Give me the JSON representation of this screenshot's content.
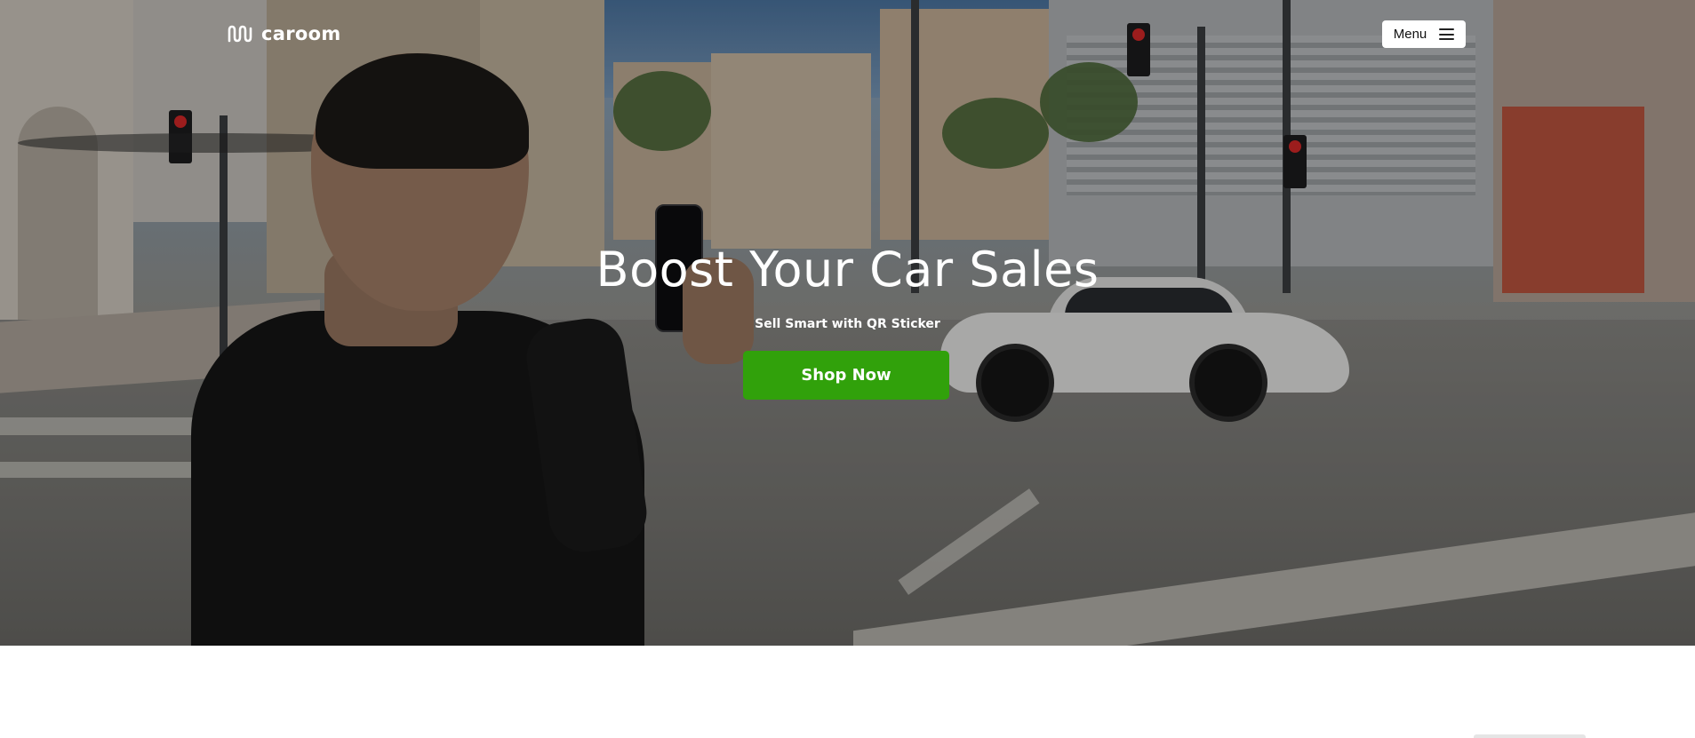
{
  "header": {
    "logo_text": "caroom",
    "menu_label": "Menu"
  },
  "hero": {
    "title": "Boost Your Car Sales",
    "subtitle": "Sell Smart with QR Sticker",
    "cta_label": "Shop Now"
  },
  "colors": {
    "cta_background": "#31a10b",
    "text": "#ffffff",
    "menu_background": "#ffffff",
    "page_background": "#ffffff"
  },
  "icons": {
    "logo": "caroom-logo-icon",
    "menu": "hamburger-icon"
  }
}
